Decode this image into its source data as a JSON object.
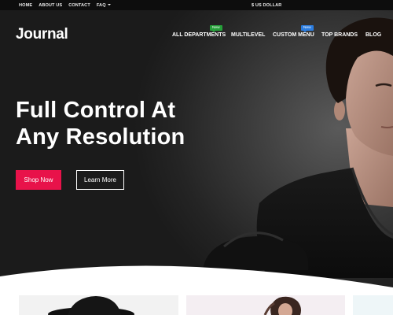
{
  "topbar": {
    "links": [
      "HOME",
      "ABOUT US",
      "CONTACT",
      "FAQ"
    ],
    "currency": "$ US DOLLAR"
  },
  "brand": {
    "logo": "Journal"
  },
  "nav": {
    "items": [
      {
        "label": "ALL DEPARTMENTS",
        "badge": "New"
      },
      {
        "label": "MULTILEVEL"
      },
      {
        "label": "CUSTOM MENU",
        "badge": "New"
      },
      {
        "label": "TOP BRANDS"
      },
      {
        "label": "BLOG"
      }
    ],
    "badge_colors": [
      "#26a03a",
      "#2b7de0"
    ]
  },
  "hero": {
    "headline_line1": "Full Control At",
    "headline_line2": "Any Resolution",
    "primary_button": "Shop Now",
    "secondary_button": "Learn More"
  },
  "colors": {
    "accent": "#e8124a",
    "topbar_bg": "#0d0d0d",
    "hero_bg": "#2b2b2b"
  }
}
